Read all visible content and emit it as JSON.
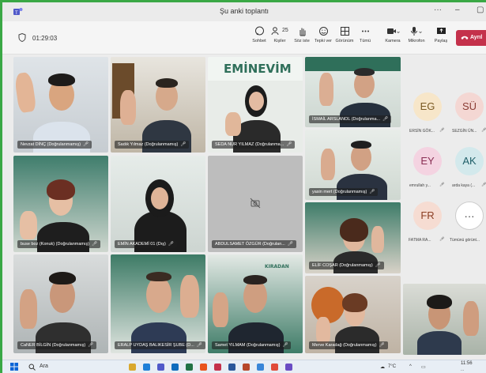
{
  "window": {
    "title": "Şu anki toplantı"
  },
  "meeting": {
    "elapsed": "01:29:03"
  },
  "toolbar": {
    "chat": "Sohbet",
    "people": "Kişiler",
    "people_count": "25",
    "raise": "Söz iste",
    "react": "Tepki ver",
    "view": "Görünüm",
    "more": "Tümü",
    "camera": "Kamera",
    "mic": "Mikrofon",
    "share": "Paylaş",
    "leave": "Ayrıl"
  },
  "tiles": [
    "Nevzat DİNÇ (Doğrulanmamış)",
    "Sadık Yılmaz (Doğrulanmamış)",
    "SEDA NUR YILMAZ (Doğrulanma...",
    "İSMAİL ARSLANOL (Doğrulanma...",
    "buse boz (Konuk) (Doğrulanmamış)",
    "EMİN AKADEMİ 01 (Dış)",
    "ABDULSAMET ÖZGÜR (Doğrulan...",
    "yasin mert (Doğrulanmamış)",
    "ELİF COŞAR (Doğrulanmamış)",
    "CaNER BİLGİN (Doğrulanmamış)",
    "ERALP UYDAŞ BALIKESİR ŞUBE (D...",
    "Samet YILMAM (Doğrulanmamış)",
    "Merve Karadağ (Doğrulanmamış)"
  ],
  "banner": {
    "brand": "EMİNEVİM"
  },
  "side": [
    {
      "initials": "EG",
      "name": "ERSİN GÖK...",
      "bg": "#f7e6c9",
      "fg": "#7a5a22"
    },
    {
      "initials": "SÜ",
      "name": "SEZGİN ÜN...",
      "bg": "#f4d7d3",
      "fg": "#8a3b33"
    },
    {
      "initials": "EY",
      "name": "emrullah y...",
      "bg": "#f4d3e1",
      "fg": "#8a2f55"
    },
    {
      "initials": "AK",
      "name": "arda kaya (...",
      "bg": "#d3e9ec",
      "fg": "#1f5f68"
    },
    {
      "initials": "FR",
      "name": "FATMA RA...",
      "bg": "#f6dcd2",
      "fg": "#8b3d22"
    },
    {
      "initials": "···",
      "name": "Tümünü görünt...",
      "bg": "#ffffff",
      "fg": "#333333"
    }
  ],
  "taskbar": {
    "search": "Ara",
    "weather": "7°C",
    "time": "11:56",
    "date": "..."
  },
  "colors": {
    "leave": "#c4314b",
    "screen_border": "#3aa845"
  }
}
